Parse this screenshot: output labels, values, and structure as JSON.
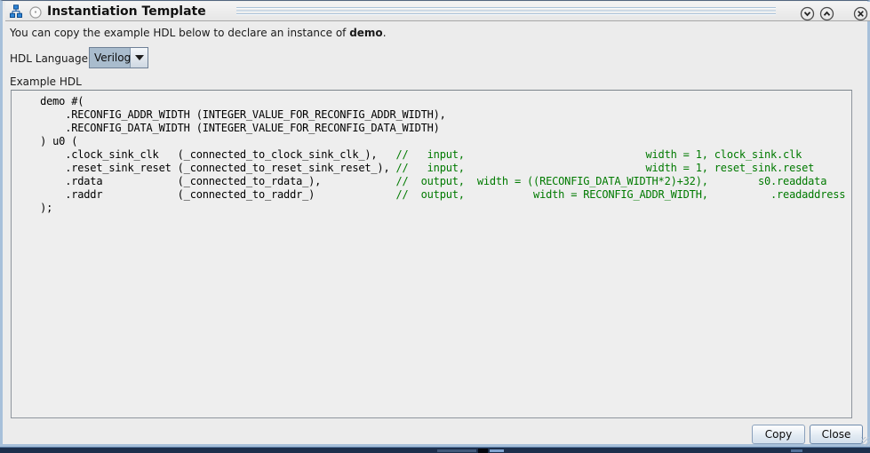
{
  "window": {
    "title": "Instantiation Template"
  },
  "description": {
    "text_before": "You can copy the example HDL below to declare an instance of ",
    "instance_name": "demo",
    "text_after": "."
  },
  "hdl_language": {
    "label": "HDL Language:",
    "selected_option": "Verilog"
  },
  "example_hdl": {
    "label": "Example HDL"
  },
  "code": {
    "lines": [
      {
        "code": "    demo #(",
        "comment": ""
      },
      {
        "code": "        .RECONFIG_ADDR_WIDTH (INTEGER_VALUE_FOR_RECONFIG_ADDR_WIDTH),",
        "comment": ""
      },
      {
        "code": "        .RECONFIG_DATA_WIDTH (INTEGER_VALUE_FOR_RECONFIG_DATA_WIDTH)",
        "comment": ""
      },
      {
        "code": "    ) u0 (",
        "comment": ""
      },
      {
        "code": "        .clock_sink_clk   (_connected_to_clock_sink_clk_),   ",
        "comment": "//   input,                             width = 1, clock_sink.clk"
      },
      {
        "code": "        .reset_sink_reset (_connected_to_reset_sink_reset_), ",
        "comment": "//   input,                             width = 1, reset_sink.reset"
      },
      {
        "code": "        .rdata            (_connected_to_rdata_),            ",
        "comment": "//  output,  width = ((RECONFIG_DATA_WIDTH*2)+32),        s0.readdata"
      },
      {
        "code": "        .raddr            (_connected_to_raddr_)             ",
        "comment": "//  output,           width = RECONFIG_ADDR_WIDTH,          .readaddress"
      },
      {
        "code": "    );",
        "comment": ""
      }
    ]
  },
  "buttons": {
    "copy": "Copy",
    "close": "Close"
  },
  "icons": {
    "titlebar_left": [
      "hierarchy-icon",
      "circle-icon"
    ],
    "titlebar_right": [
      "chevron-down-icon",
      "chevron-up-icon",
      "close-icon"
    ],
    "combo": "dropdown-arrow-icon"
  },
  "colors": {
    "comment_green": "#007a00",
    "frame_blue": "#a7c0da",
    "combo_highlight": "#a9bccd",
    "background_window_navy": "#1d2f4c"
  }
}
